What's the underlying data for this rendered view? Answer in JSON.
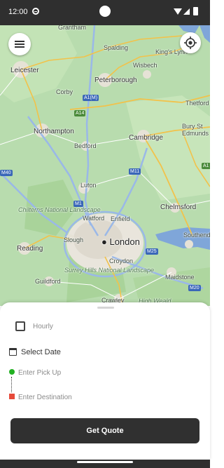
{
  "status_bar": {
    "time": "12:00",
    "icons": [
      "sync-icon",
      "wifi-icon",
      "signal-icon",
      "battery-icon"
    ]
  },
  "map": {
    "towns": [
      "Grantham",
      "Spalding",
      "King's Lynn",
      "Leicester",
      "Wisbech",
      "Peterborough",
      "Thetford",
      "Corby",
      "Northampton",
      "Cambridge",
      "Bury St Edmunds",
      "Bedford",
      "Luton",
      "Watford",
      "Enfield",
      "Chelmsford",
      "Slough",
      "Reading",
      "Croydon",
      "Southend",
      "Guildford",
      "Crawley",
      "Maidstone"
    ],
    "capital": "London",
    "regions": [
      "Chilterns National Landscape",
      "Surrey Hills National Landscape",
      "High Weald"
    ],
    "road_shields": [
      "A1(M)",
      "A14",
      "M40",
      "M1",
      "M11",
      "M25",
      "M20",
      "A1"
    ],
    "colors": {
      "land": "#b8dcae",
      "urban": "#e9e5dc",
      "water": "#7fa6d9",
      "motorway": "#9ab8e8",
      "trunk": "#f2c24a"
    }
  },
  "controls": {
    "menu_icon": "hamburger-menu-icon",
    "locate_icon": "my-location-icon"
  },
  "booking": {
    "hourly_label": "Hourly",
    "hourly_checked": false,
    "date_label": "Select Date",
    "date_icon": "calendar-icon",
    "pickup_placeholder": "Enter Pick Up",
    "destination_placeholder": "Enter Destination",
    "quote_button": "Get Quote",
    "pickup_marker_color": "#21b021",
    "destination_marker_color": "#e64a3a"
  }
}
